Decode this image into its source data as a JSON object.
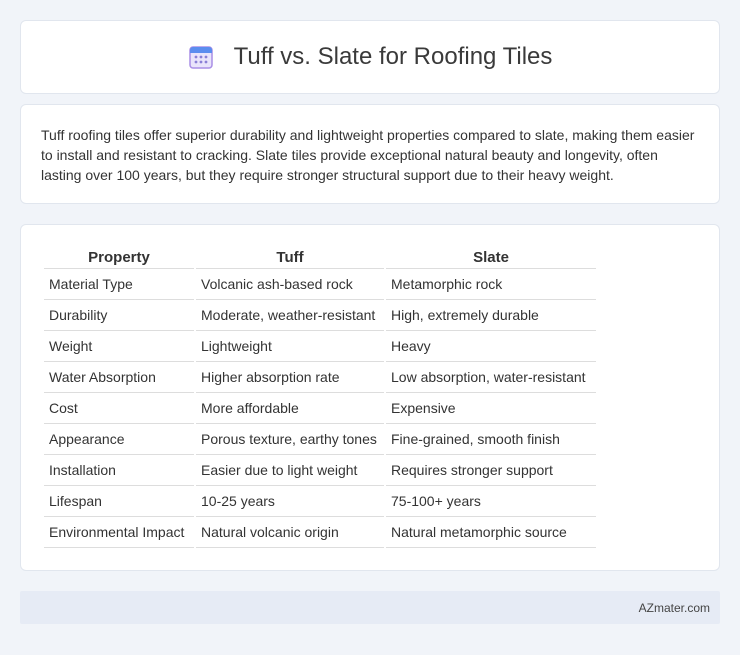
{
  "header": {
    "title": "Tuff vs. Slate for Roofing Tiles",
    "icon": "calendar-icon"
  },
  "summary": {
    "text": "Tuff roofing tiles offer superior durability and lightweight properties compared to slate, making them easier to install and resistant to cracking. Slate tiles provide exceptional natural beauty and longevity, often lasting over 100 years, but they require stronger structural support due to their heavy weight."
  },
  "table": {
    "headers": [
      "Property",
      "Tuff",
      "Slate"
    ],
    "rows": [
      [
        "Material Type",
        "Volcanic ash-based rock",
        "Metamorphic rock"
      ],
      [
        "Durability",
        "Moderate, weather-resistant",
        "High, extremely durable"
      ],
      [
        "Weight",
        "Lightweight",
        "Heavy"
      ],
      [
        "Water Absorption",
        "Higher absorption rate",
        "Low absorption, water-resistant"
      ],
      [
        "Cost",
        "More affordable",
        "Expensive"
      ],
      [
        "Appearance",
        "Porous texture, earthy tones",
        "Fine-grained, smooth finish"
      ],
      [
        "Installation",
        "Easier due to light weight",
        "Requires stronger support"
      ],
      [
        "Lifespan",
        "10-25 years",
        "75-100+ years"
      ],
      [
        "Environmental Impact",
        "Natural volcanic origin",
        "Natural metamorphic source"
      ]
    ]
  },
  "footer": {
    "brand": "AZmater.com"
  },
  "colors": {
    "background": "#f1f4f9",
    "card": "#ffffff",
    "footer": "#e6ebf5",
    "icon_blue": "#5b8def",
    "icon_purple": "#a98ee6"
  }
}
